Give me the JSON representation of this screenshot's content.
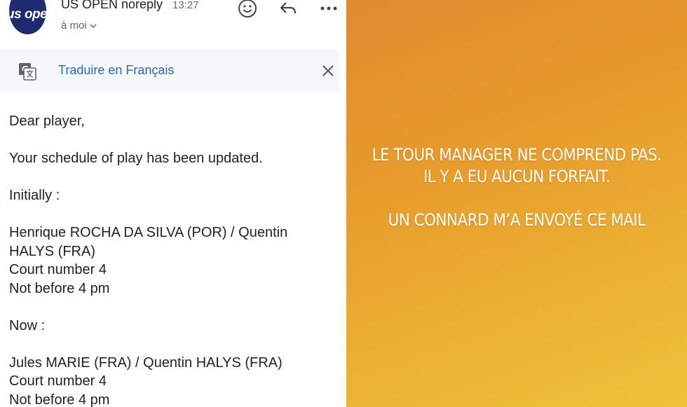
{
  "email": {
    "avatar_logo_text": "us open",
    "sender_name": "US OPEN noreply",
    "time": "13:27",
    "recipient": "à moi",
    "icons": {
      "emoji": "smiley-face-icon",
      "reply": "reply-arrow-icon",
      "more": "more-horizontal-icon",
      "translate": "translate-icon",
      "close": "close-icon",
      "chevron": "chevron-down-icon"
    },
    "translate_label": "Traduire en Français",
    "body": {
      "greeting": "Dear player,",
      "update_line": "Your schedule of play has been updated.",
      "initially_label": "Initially :",
      "initial_match_line1": "Henrique ROCHA DA SILVA (POR) / Quentin",
      "initial_match_line2": "HALYS (FRA)",
      "initial_court": "Court number 4",
      "initial_time": "Not before 4 pm",
      "now_label": "Now :",
      "new_match": "Jules MARIE (FRA) / Quentin HALYS (FRA)",
      "new_court": "Court number 4",
      "new_time": "Not before 4 pm"
    }
  },
  "story": {
    "line1": "LE TOUR MANAGER NE COMPREND PAS.",
    "line2": "IL Y A EU AUCUN FORFAIT.",
    "line3": "UN CONNARD M’A ENVOYÉ CE MAIL"
  }
}
